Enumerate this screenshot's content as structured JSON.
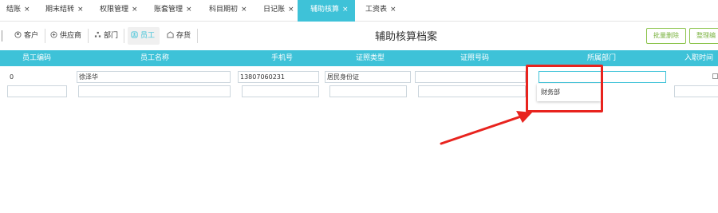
{
  "tabs": [
    {
      "label": "结账",
      "close": "×"
    },
    {
      "label": "期末结转",
      "close": "×"
    },
    {
      "label": "权限管理",
      "close": "×"
    },
    {
      "label": "账套管理",
      "close": "×"
    },
    {
      "label": "科目期初",
      "close": "×"
    },
    {
      "label": "日记账",
      "close": "×"
    },
    {
      "label": "辅助核算",
      "close": "×"
    },
    {
      "label": "工资表",
      "close": "×"
    }
  ],
  "categories": [
    {
      "label": "客户",
      "icon": "user-icon"
    },
    {
      "label": "供应商",
      "icon": "supplier-icon"
    },
    {
      "label": "部门",
      "icon": "department-icon"
    },
    {
      "label": "员工",
      "icon": "employee-icon"
    },
    {
      "label": "存货",
      "icon": "inventory-icon"
    }
  ],
  "page_title": "辅助核算档案",
  "buttons": {
    "batch_delete": "批量删除",
    "organize": "整理编"
  },
  "table": {
    "columns": [
      "员工编码",
      "员工名称",
      "手机号",
      "证照类型",
      "证照号码",
      "所属部门",
      "入职时间"
    ],
    "rows": [
      {
        "code": "0",
        "name": "徐泽华",
        "phone": "13807060231",
        "id_type": "居民身份证",
        "id_number": "",
        "department": "",
        "hire_date": ""
      },
      {
        "code": "",
        "name": "",
        "phone": "",
        "id_type": "",
        "id_number": "",
        "department": "",
        "hire_date": ""
      }
    ]
  },
  "dropdown": {
    "options": [
      "财务部"
    ]
  },
  "colors": {
    "accent": "#3ec2d8",
    "highlight": "#e8231e",
    "button_green": "#7cb342"
  }
}
